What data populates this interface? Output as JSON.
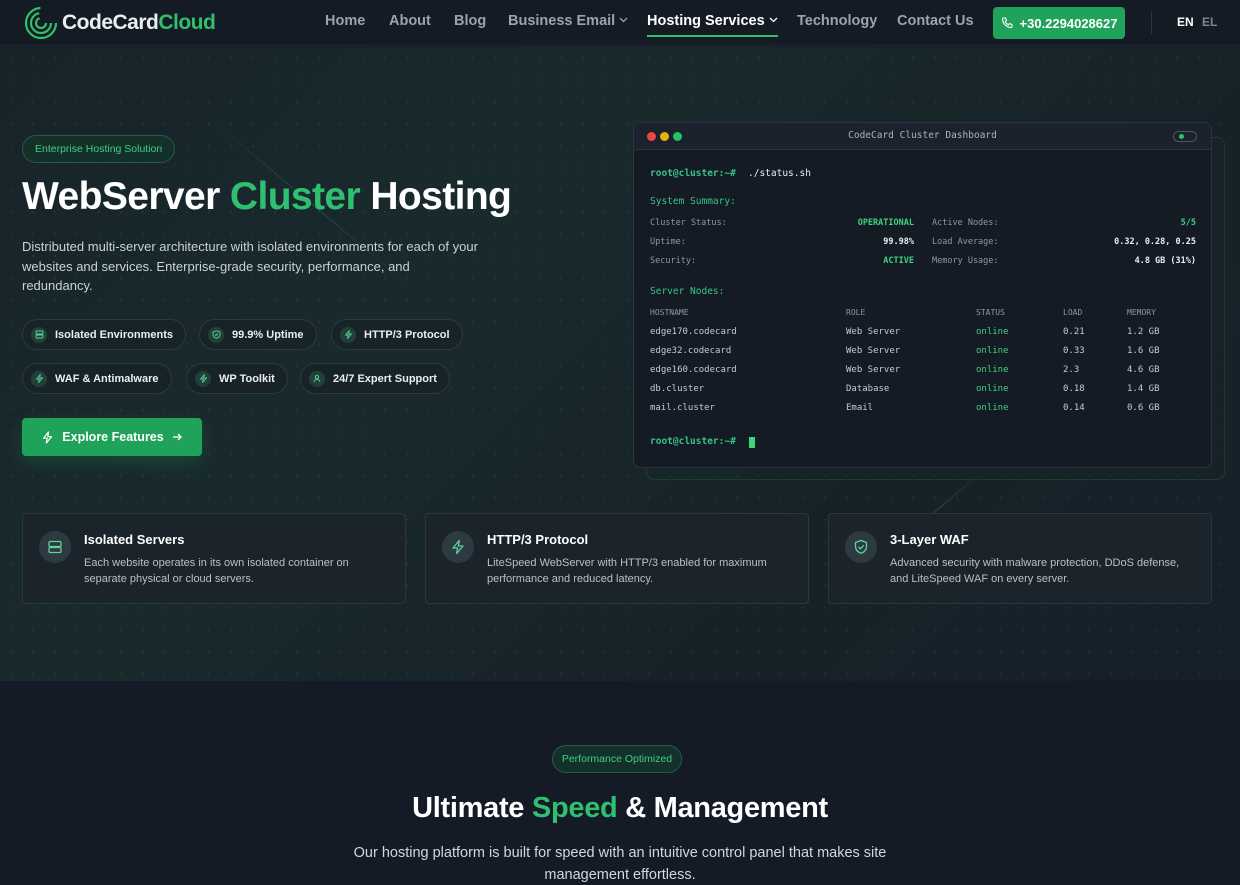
{
  "brand": {
    "name_part1": "CodeCard",
    "name_part2": "Cloud"
  },
  "nav": {
    "items": [
      "Home",
      "About",
      "Blog",
      "Business Email",
      "Hosting Services",
      "Technology",
      "Contact Us"
    ],
    "phone": "+30.2294028627",
    "lang_active": "EN",
    "lang_other": "EL"
  },
  "hero": {
    "badge": "Enterprise Hosting Solution",
    "title_pre": "WebServer ",
    "title_accent": "Cluster",
    "title_post": " Hosting",
    "description": "Distributed multi-server architecture with isolated environments for each of your websites and services. Enterprise-grade security, performance, and redundancy.",
    "chips": [
      "Isolated Environments",
      "99.9% Uptime",
      "HTTP/3 Protocol",
      "WAF & Antimalware",
      "WP Toolkit",
      "24/7 Expert Support"
    ],
    "cta": "Explore Features"
  },
  "terminal": {
    "title": "CodeCard Cluster Dashboard",
    "prompt": "root@cluster:~#",
    "command": "./status.sh",
    "summary_heading": "System Summary:",
    "summary": [
      {
        "label": "Cluster Status:",
        "value": "OPERATIONAL"
      },
      {
        "label": "Active Nodes:",
        "value": "5/5"
      },
      {
        "label": "Uptime:",
        "value": "99.98%"
      },
      {
        "label": "Load Average:",
        "value": "0.32, 0.28, 0.25"
      },
      {
        "label": "Security:",
        "value": "ACTIVE"
      },
      {
        "label": "Memory Usage:",
        "value": "4.8 GB (31%)"
      }
    ],
    "nodes_heading": "Server Nodes:",
    "columns": [
      "HOSTNAME",
      "ROLE",
      "STATUS",
      "LOAD",
      "MEMORY"
    ],
    "rows": [
      [
        "edge170.codecard",
        "Web Server",
        "online",
        "0.21",
        "1.2 GB"
      ],
      [
        "edge32.codecard",
        "Web Server",
        "online",
        "0.33",
        "1.6 GB"
      ],
      [
        "edge160.codecard",
        "Web Server",
        "online",
        "2.3",
        "4.6 GB"
      ],
      [
        "db.cluster",
        "Database",
        "online",
        "0.18",
        "1.4 GB"
      ],
      [
        "mail.cluster",
        "Email",
        "online",
        "0.14",
        "0.6 GB"
      ]
    ]
  },
  "features": [
    {
      "title": "Isolated Servers",
      "text": "Each website operates in its own isolated container on separate physical or cloud servers."
    },
    {
      "title": "HTTP/3 Protocol",
      "text": "LiteSpeed WebServer with HTTP/3 enabled for maximum performance and reduced latency."
    },
    {
      "title": "3-Layer WAF",
      "text": "Advanced security with malware protection, DDoS defense, and LiteSpeed WAF on every server."
    }
  ],
  "section2": {
    "badge": "Performance Optimized",
    "title_pre": "Ultimate ",
    "title_accent": "Speed",
    "title_post": " & Management",
    "description": "Our hosting platform is built for speed with an intuitive control panel that makes site management effortless."
  },
  "colors": {
    "accent": "#2ec06a",
    "button": "#1fa25a",
    "background": "#151c26"
  }
}
